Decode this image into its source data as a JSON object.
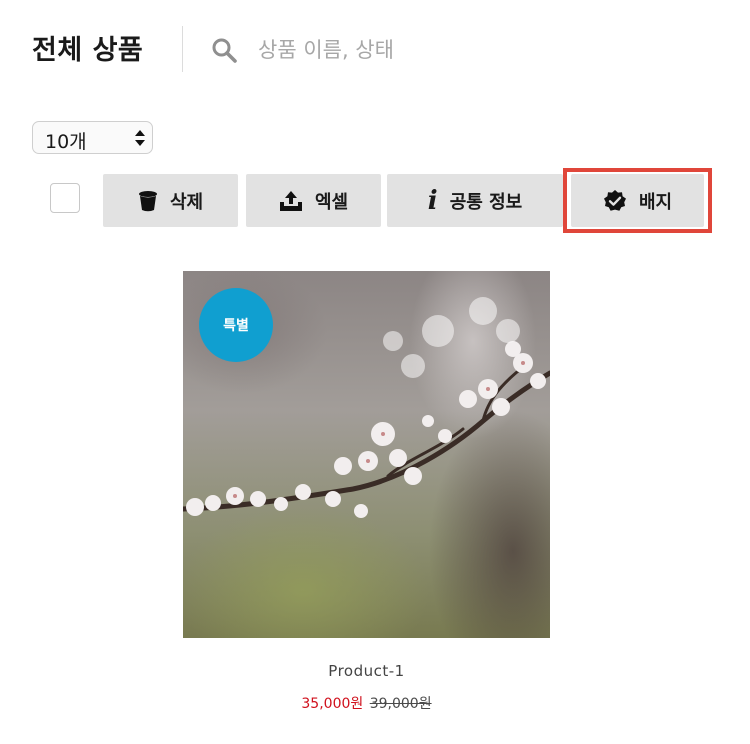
{
  "header": {
    "title": "전체 상품",
    "search_placeholder": "상품 이름, 상태"
  },
  "per_page": {
    "selected": "10개"
  },
  "toolbar": {
    "buttons": [
      {
        "label": "삭제",
        "icon": "trash-icon"
      },
      {
        "label": "엑셀",
        "icon": "upload-icon"
      },
      {
        "label": "공통 정보",
        "icon": "info-icon"
      },
      {
        "label": "배지",
        "icon": "verified-badge-icon",
        "highlighted": true
      }
    ]
  },
  "products": [
    {
      "badge": "특별",
      "name": "Product-1",
      "sale_price": "35,000원",
      "original_price": "39,000원"
    }
  ],
  "colors": {
    "badge": "#109fd0",
    "sale_price": "#d0101c",
    "highlight_border": "#e0463a",
    "toolbar_button": "#e2e2e2"
  }
}
